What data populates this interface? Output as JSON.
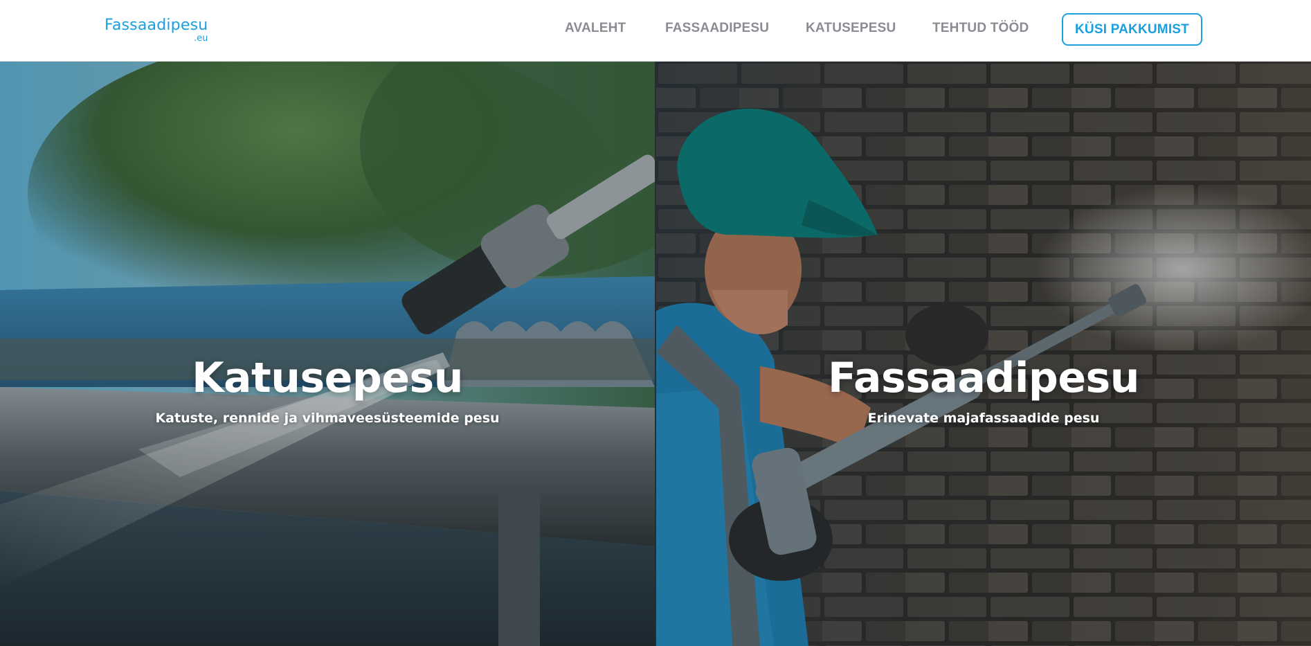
{
  "header": {
    "logo": {
      "name": "Fassaadipesu",
      "tld": ".eu"
    },
    "nav": [
      {
        "label": "AVALEHT"
      },
      {
        "label": "FASSAADIPESU"
      },
      {
        "label": "KATUSEPESU"
      },
      {
        "label": "TEHTUD TÖÖD"
      }
    ],
    "cta_label": "KÜSI PAKKUMIST"
  },
  "hero": {
    "panels": [
      {
        "title": "Katusepesu",
        "subtitle": "Katuste, rennide ja vihmaveesüsteemide pesu",
        "image": "roof-gutter-pressure-washing-photo"
      },
      {
        "title": "Fassaadipesu",
        "subtitle": "Erinevate majafassaadide pesu",
        "image": "worker-washing-brick-facade-photo"
      }
    ]
  },
  "colors": {
    "brand": "#1aa0e0",
    "nav_text": "#8b8b93",
    "header_bg": "#ffffff"
  }
}
